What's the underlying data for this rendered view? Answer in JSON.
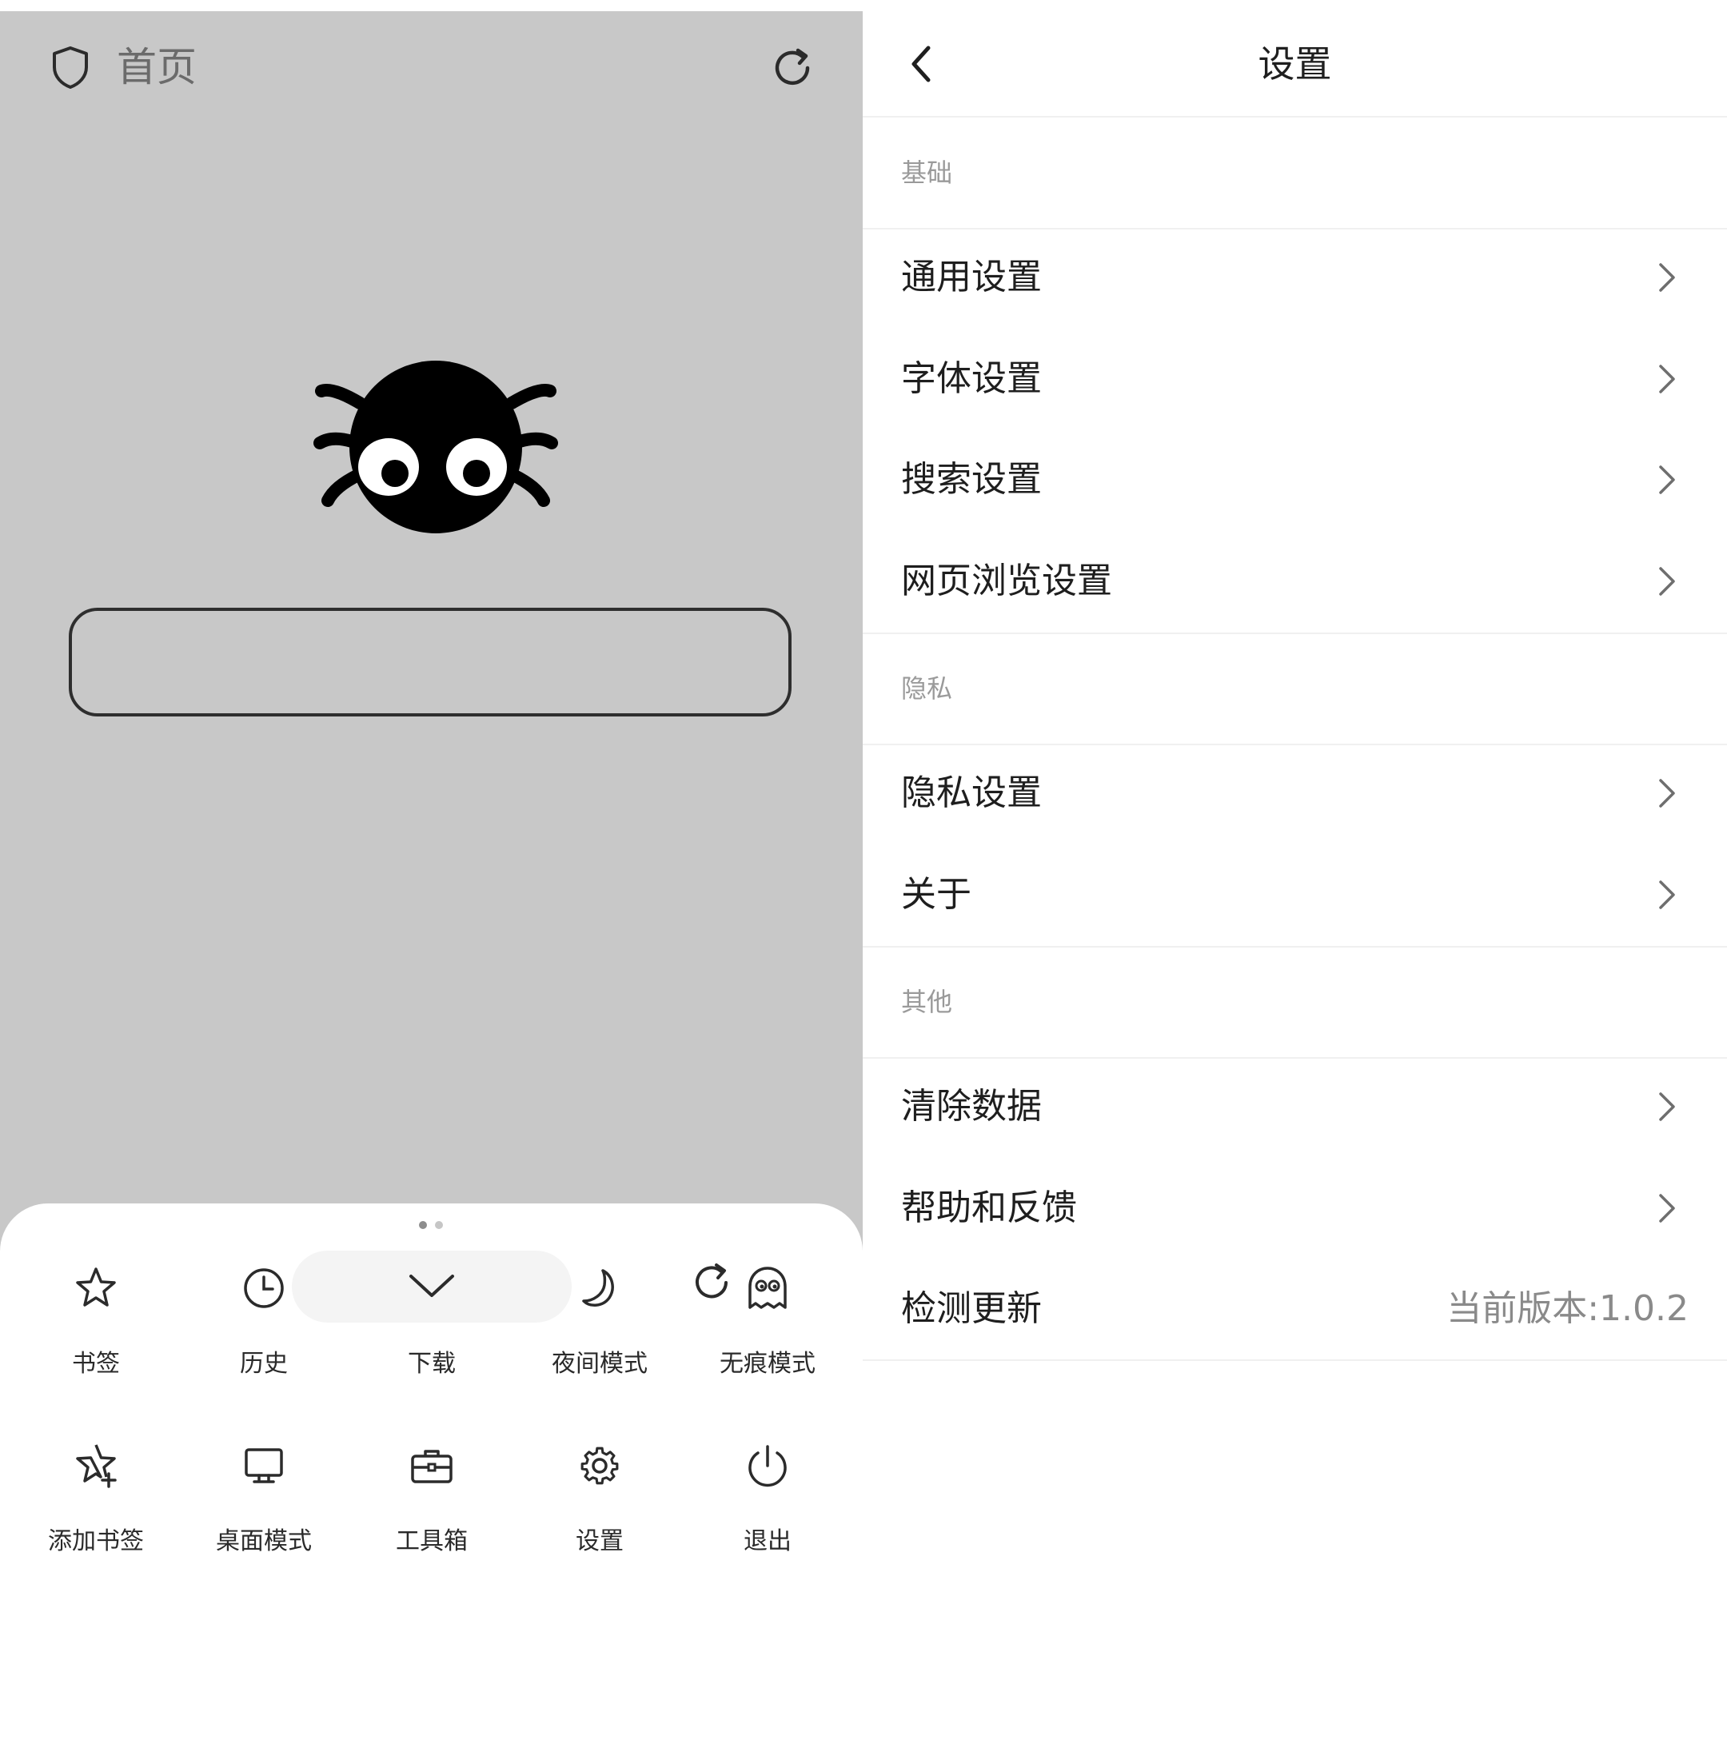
{
  "browser": {
    "title": "首页",
    "search_value": "",
    "menu": {
      "items": [
        {
          "label": "书签",
          "icon": "star-icon"
        },
        {
          "label": "历史",
          "icon": "clock-icon"
        },
        {
          "label": "下载",
          "icon": "download-icon"
        },
        {
          "label": "夜间模式",
          "icon": "moon-icon"
        },
        {
          "label": "无痕模式",
          "icon": "ghost-icon"
        },
        {
          "label": "添加书签",
          "icon": "star-plus-icon"
        },
        {
          "label": "桌面模式",
          "icon": "monitor-icon"
        },
        {
          "label": "工具箱",
          "icon": "toolbox-icon"
        },
        {
          "label": "设置",
          "icon": "gear-icon"
        },
        {
          "label": "退出",
          "icon": "power-icon"
        }
      ],
      "page_count": 2,
      "current_page": 1
    }
  },
  "settings": {
    "title": "设置",
    "sections": [
      {
        "header": "基础",
        "rows": [
          {
            "label": "通用设置"
          },
          {
            "label": "字体设置"
          },
          {
            "label": "搜索设置"
          },
          {
            "label": "网页浏览设置"
          }
        ]
      },
      {
        "header": "隐私",
        "rows": [
          {
            "label": "隐私设置"
          },
          {
            "label": "关于"
          }
        ]
      },
      {
        "header": "其他",
        "rows": [
          {
            "label": "清除数据"
          },
          {
            "label": "帮助和反馈"
          },
          {
            "label": "检测更新",
            "value": "当前版本:1.0.2"
          }
        ]
      }
    ]
  },
  "colors": {
    "left_background": "#c8c8c8",
    "sheet_background": "#ffffff",
    "text_primary": "#1e1e1e",
    "text_secondary": "#9a9a9a",
    "divider": "#f0f0f0"
  }
}
